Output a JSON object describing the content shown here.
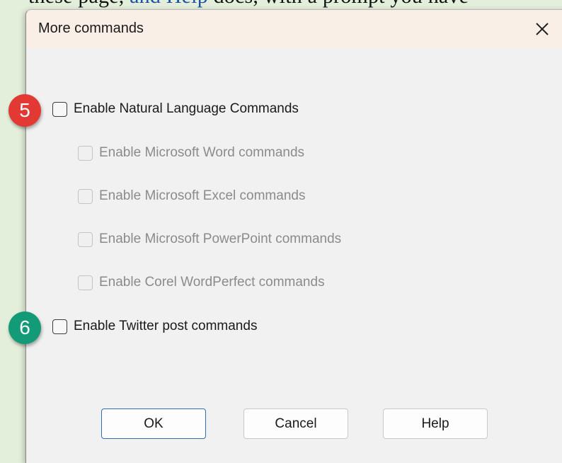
{
  "background": {
    "text_before_link": "these page, ",
    "link_text": "and Help",
    "text_after_link": " docs, with a prompt you have"
  },
  "dialog": {
    "title": "More commands",
    "close_icon": "close-icon"
  },
  "options": {
    "natural_language": {
      "label": "Enable Natural Language Commands",
      "checked": false,
      "enabled": true
    },
    "word": {
      "label": "Enable Microsoft Word commands",
      "checked": false,
      "enabled": false
    },
    "excel": {
      "label": "Enable Microsoft Excel commands",
      "checked": false,
      "enabled": false
    },
    "powerpoint": {
      "label": "Enable Microsoft PowerPoint commands",
      "checked": false,
      "enabled": false
    },
    "wordperfect": {
      "label": "Enable Corel WordPerfect commands",
      "checked": false,
      "enabled": false
    },
    "twitter": {
      "label": "Enable Twitter post commands",
      "checked": false,
      "enabled": true
    }
  },
  "badges": {
    "step5": "5",
    "step6": "6"
  },
  "buttons": {
    "ok": "OK",
    "cancel": "Cancel",
    "help": "Help"
  },
  "colors": {
    "badge_red": "#e33935",
    "badge_teal": "#139a77",
    "primary_border": "#2f6db5",
    "titlebar": "#f9efe6"
  }
}
